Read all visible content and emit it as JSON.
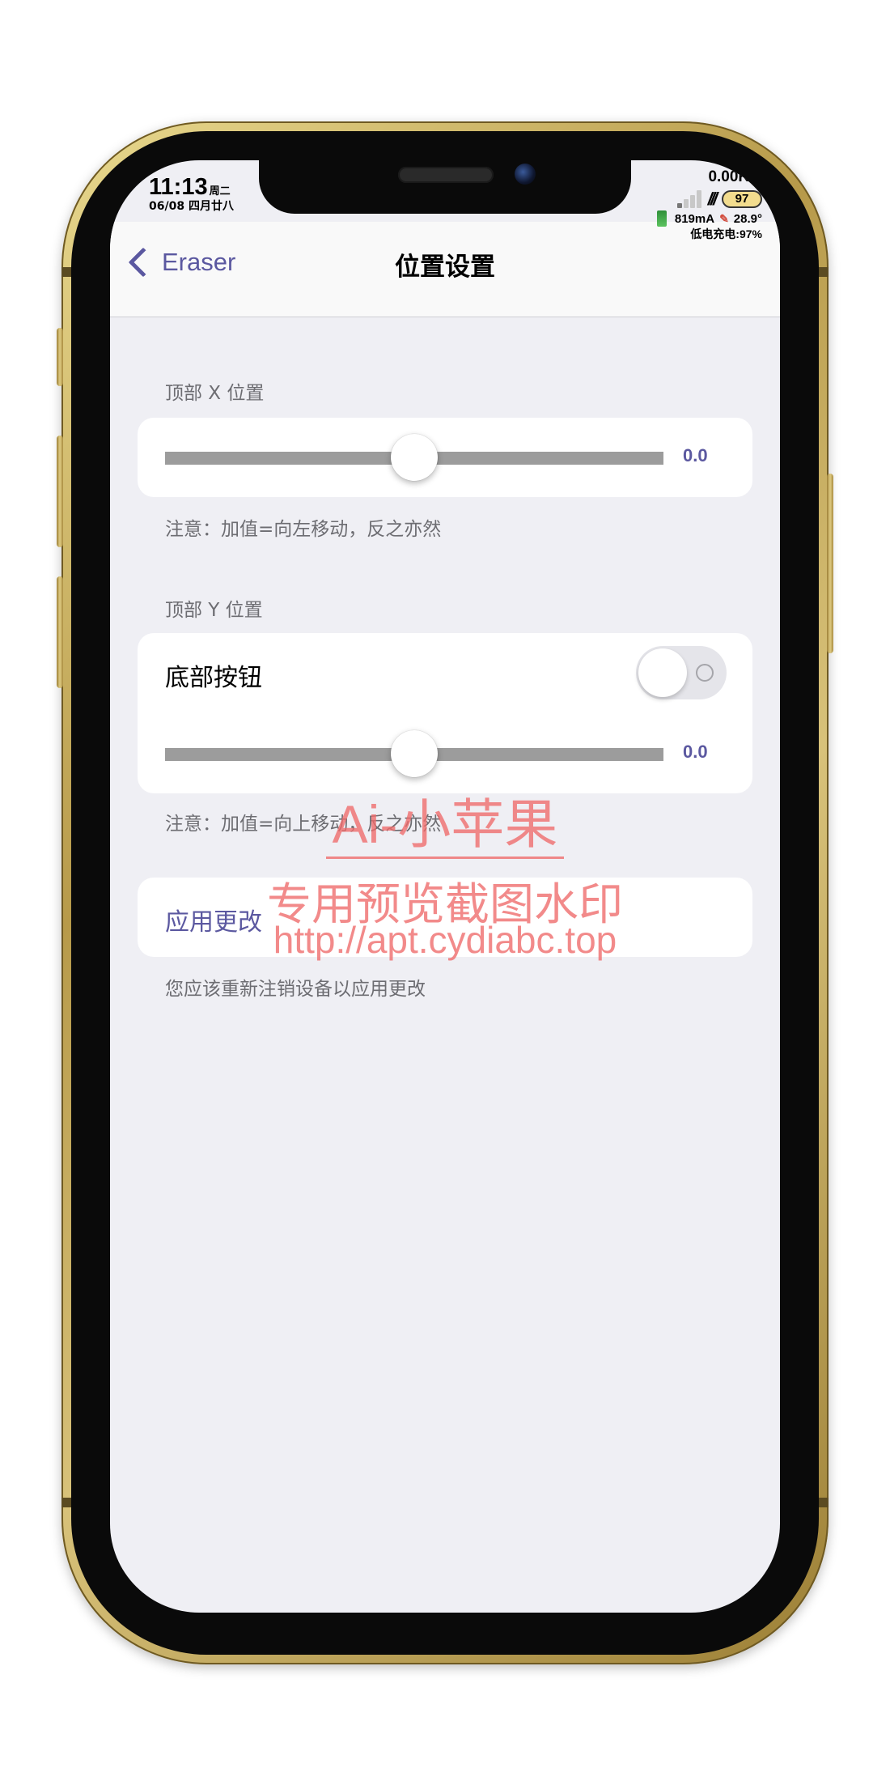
{
  "status_bar": {
    "time": "11:13",
    "weekday": "周二",
    "date": "06/08 四月廿八",
    "net_speed": "0.00K/s",
    "battery_level": "97",
    "current": "819mA",
    "temperature": "28.9°",
    "charge_status": "低电充电:97%"
  },
  "nav": {
    "back_label": "Eraser",
    "title": "位置设置"
  },
  "top_x": {
    "header": "顶部 X 位置",
    "slider_value": "0.0",
    "slider_fraction": 0.5,
    "footer": "注意：加值=向左移动，反之亦然"
  },
  "top_y": {
    "header": "顶部 Y 位置",
    "toggle_label": "底部按钮",
    "toggle_on": false,
    "slider_value": "0.0",
    "slider_fraction": 0.5,
    "footer": "注意：加值=向上移动，反之亦然"
  },
  "apply": {
    "label": "应用更改",
    "footer": "您应该重新注销设备以应用更改"
  },
  "watermark": {
    "line1": "Ai-小苹果",
    "line2": "专用预览截图水印",
    "line3": "http://apt.cydiabc.top"
  },
  "colors": {
    "accent": "#5b58a0",
    "background": "#efeff4",
    "slider_track": "#9c9c9c",
    "phone_frame": "#c8ad5c",
    "watermark": "#ee6969"
  }
}
